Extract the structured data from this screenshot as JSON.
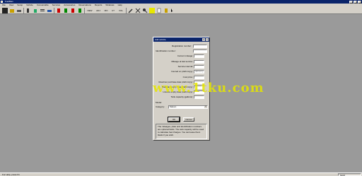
{
  "window": {
    "title": "FuelMan"
  },
  "menu": [
    "File",
    "View",
    "Setup",
    "Vehicle",
    "Consumable",
    "Services",
    "Accessories",
    "Reservations",
    "Reports",
    "Windows",
    "Help"
  ],
  "toolbar": {
    "labels": [
      "NEW",
      "ADJ",
      "MO",
      "CT",
      "VOL"
    ]
  },
  "dialog": {
    "title": "Add vehicle",
    "help_glyph": "?",
    "close_glyph": "×",
    "fields": [
      {
        "label": "Registration number:",
        "value": ""
      },
      {
        "label": "Identification number:",
        "value": ""
      },
      {
        "label": "Current mileage:",
        "value": ""
      },
      {
        "label": "Mileage at last service:",
        "value": ""
      },
      {
        "label": "Service interval:",
        "value": ""
      },
      {
        "label": "Insured on (dd/mm/yy):",
        "value": "dd/mm/yy"
      },
      {
        "label": "Cost price:",
        "value": ""
      },
      {
        "label": "Road tax purchase date (dd/mm/yy):",
        "value": ""
      },
      {
        "label": "Road tax expiry date (dd/mm/yy):",
        "value": ""
      },
      {
        "label": "Licence expiry date (dd/mm/yy):",
        "value": ""
      },
      {
        "label": "Tank capacity (gallons):",
        "value": ""
      }
    ],
    "model_label": "Model:",
    "category_label": "Category:",
    "category_value": "Saloon",
    "ok_label": "OK",
    "cancel_label": "Cancel",
    "note": "The mileages, plate and identification numbers\nare optional fields. The tank capacity will be used\nto calculate fuel charges. You can leave them\nblank if you wish."
  },
  "status": {
    "help": "For Help, press F1",
    "right": "NUM"
  },
  "watermark": "www.1tku.com",
  "colors": {
    "title_bg": "#0a246a",
    "face": "#d4d0c8",
    "workspace": "#9a9a9a",
    "watermark": "#e6e600"
  }
}
